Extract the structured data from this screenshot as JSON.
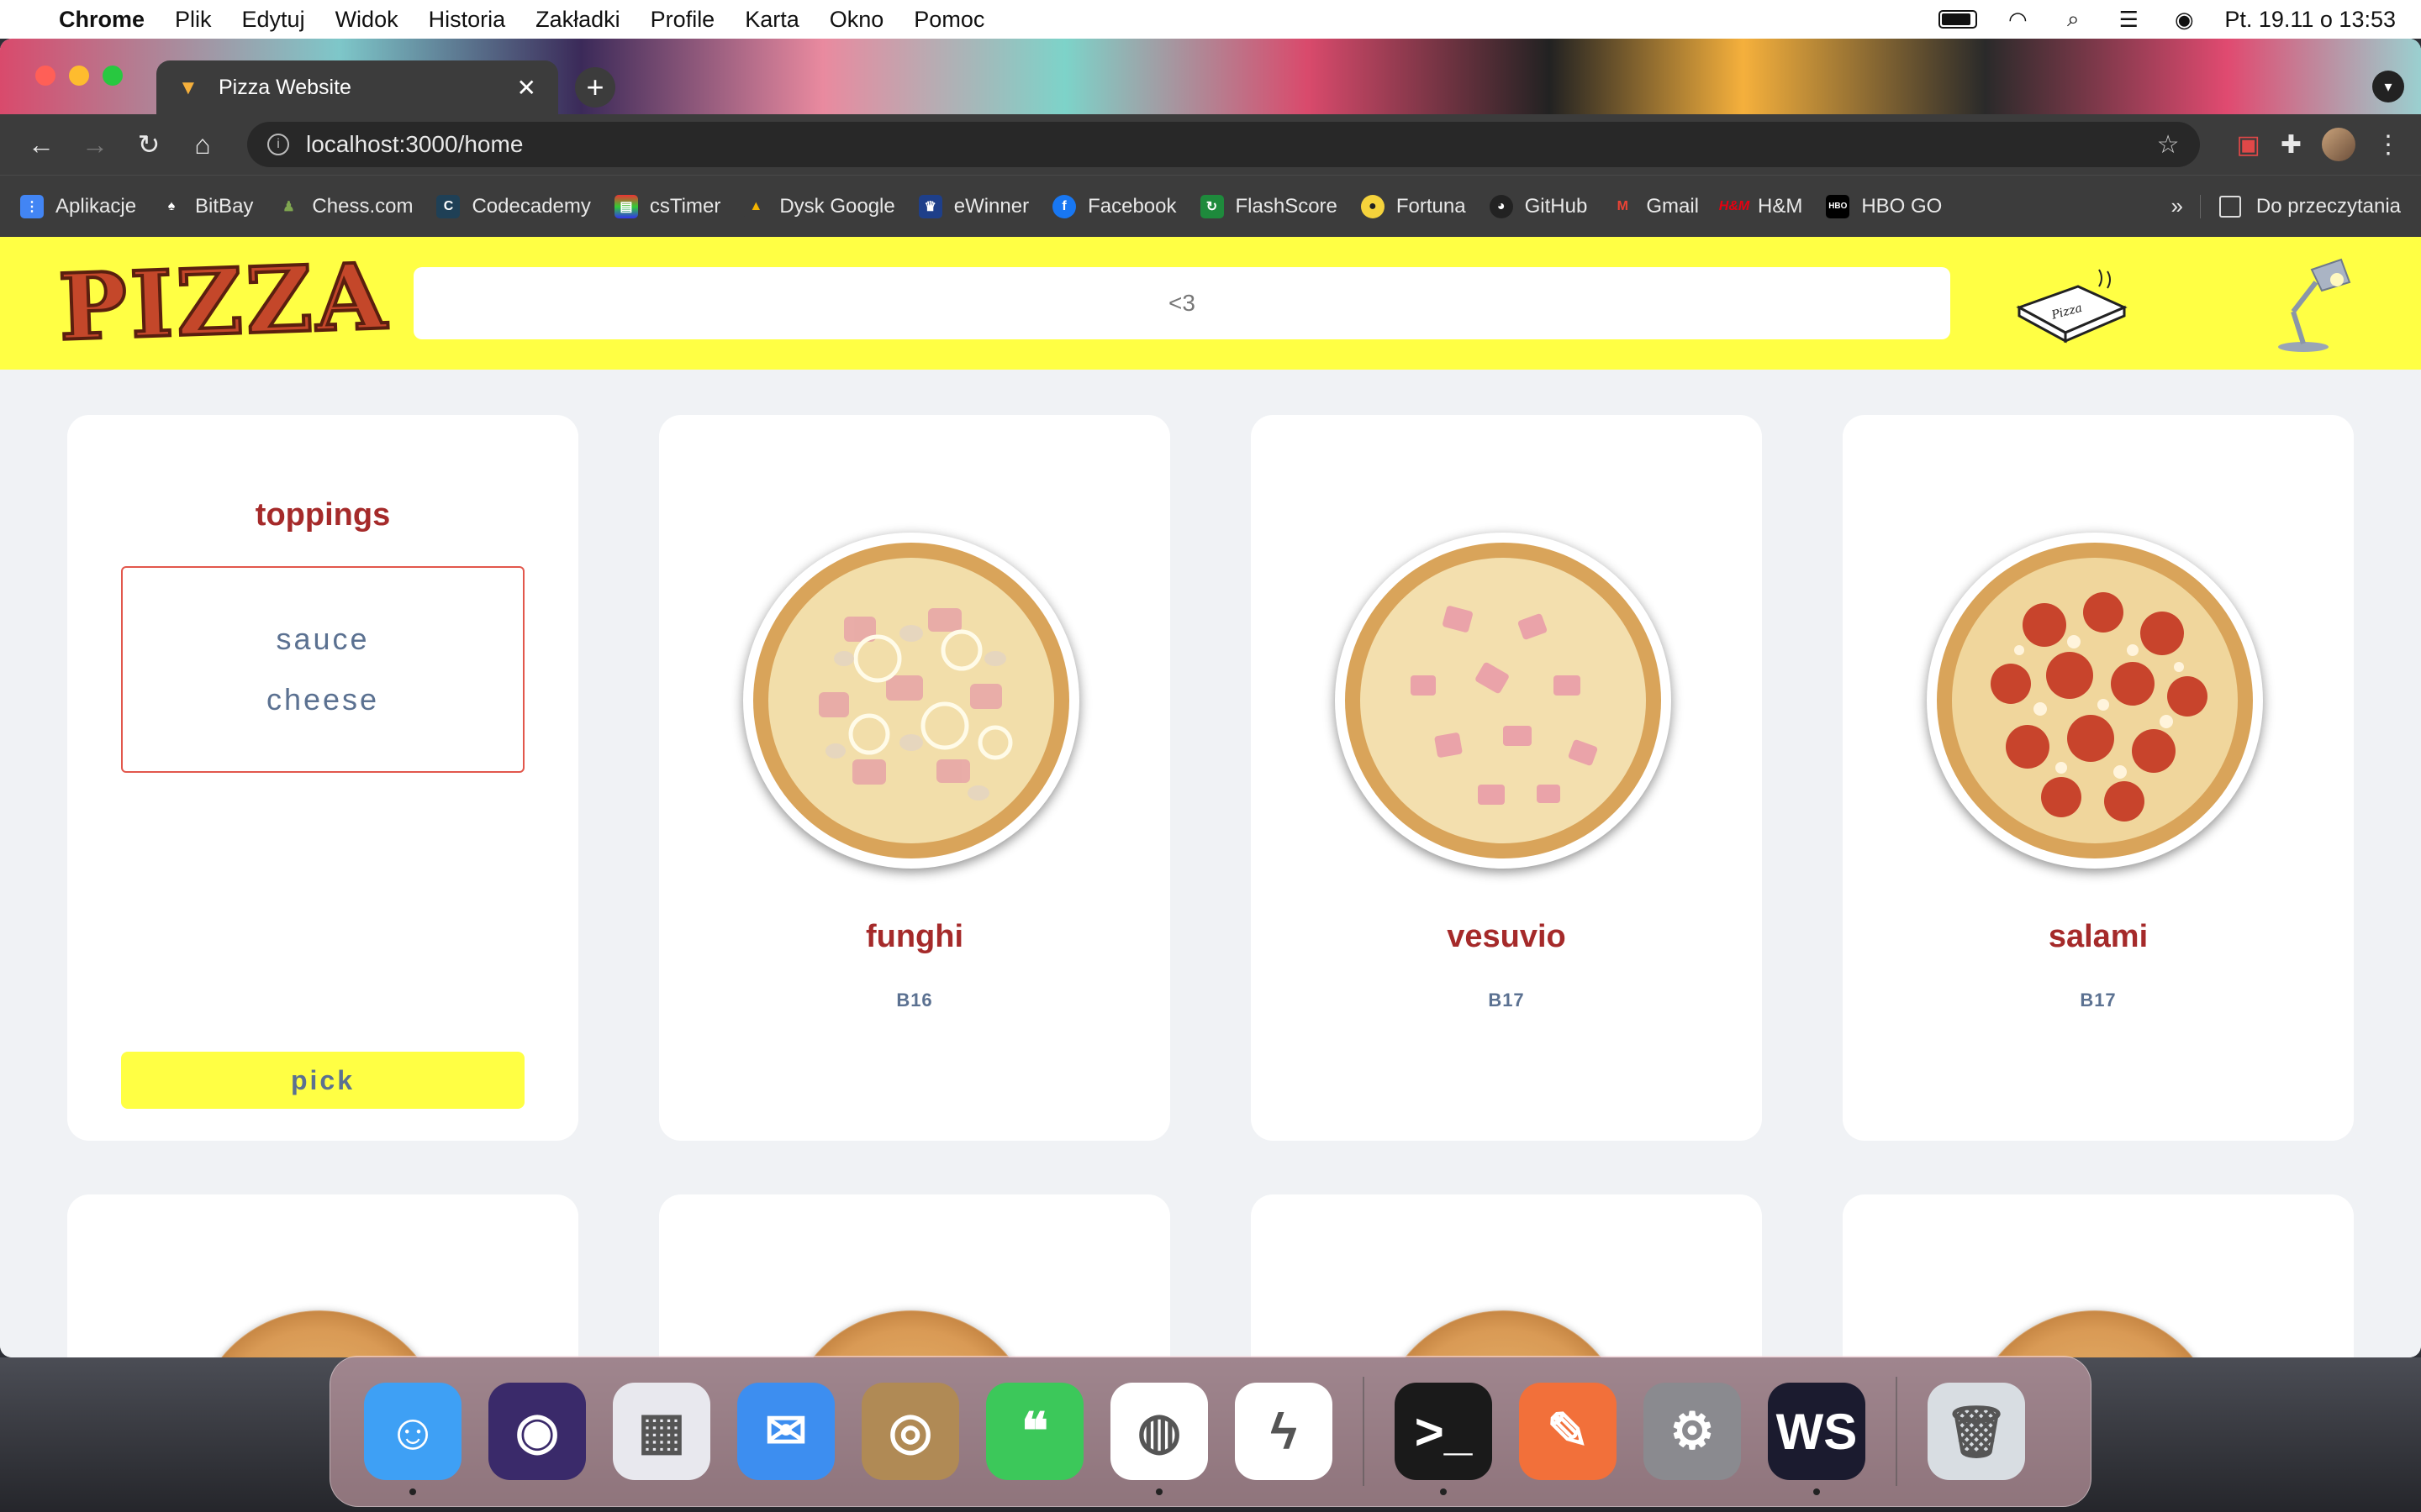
{
  "menubar": {
    "app": "Chrome",
    "items": [
      "Plik",
      "Edytuj",
      "Widok",
      "Historia",
      "Zakładki",
      "Profile",
      "Karta",
      "Okno",
      "Pomoc"
    ],
    "datetime": "Pt. 19.11 o  13:53"
  },
  "browser": {
    "tab_title": "Pizza Website",
    "url": "localhost:3000/home",
    "bookmarks": [
      {
        "label": "Aplikacje",
        "icon": "apps-grid-icon",
        "color": "#4285f4"
      },
      {
        "label": "BitBay",
        "icon": "bitbay-icon",
        "color": "#3c3c3c"
      },
      {
        "label": "Chess.com",
        "icon": "chess-pawn-icon",
        "color": "#7fa650"
      },
      {
        "label": "Codecademy",
        "icon": "codecademy-icon",
        "color": "#1f4056"
      },
      {
        "label": "csTimer",
        "icon": "cstimer-icon",
        "color": "#888888"
      },
      {
        "label": "Dysk Google",
        "icon": "google-drive-icon",
        "color": "#0f9d58"
      },
      {
        "label": "eWinner",
        "icon": "ewinner-icon",
        "color": "#1e3f8a"
      },
      {
        "label": "Facebook",
        "icon": "facebook-icon",
        "color": "#1877f2"
      },
      {
        "label": "FlashScore",
        "icon": "flashscore-icon",
        "color": "#1e8a3c"
      },
      {
        "label": "Fortuna",
        "icon": "fortuna-icon",
        "color": "#f5d33c"
      },
      {
        "label": "GitHub",
        "icon": "github-icon",
        "color": "#222222"
      },
      {
        "label": "Gmail",
        "icon": "gmail-icon",
        "color": "#ea4335"
      },
      {
        "label": "H&M",
        "icon": "hm-icon",
        "color": "#e50010"
      },
      {
        "label": "HBO GO",
        "icon": "hbo-go-icon",
        "color": "#000000"
      }
    ],
    "bookmarks_more": "»",
    "reading_list": "Do przeczytania"
  },
  "site": {
    "search_value": "<3",
    "toppings": {
      "title": "toppings",
      "items": [
        "sauce",
        "cheese"
      ],
      "pick_label": "pick"
    },
    "pizzas": [
      {
        "name": "funghi",
        "code": "B16"
      },
      {
        "name": "vesuvio",
        "code": "B17"
      },
      {
        "name": "salami",
        "code": "B17"
      }
    ]
  },
  "dock": {
    "apps": [
      {
        "name": "finder",
        "color": "#3ea0f5",
        "glyph": "☺",
        "running": true
      },
      {
        "name": "siri",
        "color": "#3a2a6a",
        "glyph": "◉",
        "running": false
      },
      {
        "name": "launchpad",
        "color": "#e8e8ee",
        "glyph": "▦",
        "running": false
      },
      {
        "name": "mail",
        "color": "#3d8ef0",
        "glyph": "✉",
        "running": false
      },
      {
        "name": "contacts",
        "color": "#b08a55",
        "glyph": "◎",
        "running": false
      },
      {
        "name": "messages",
        "color": "#3cc85a",
        "glyph": "❝",
        "running": false
      },
      {
        "name": "chrome",
        "color": "#ffffff",
        "glyph": "◍",
        "running": true
      },
      {
        "name": "messenger",
        "color": "#ffffff",
        "glyph": "ϟ",
        "running": false
      },
      {
        "name": "terminal",
        "color": "#1a1a1a",
        "glyph": ">_",
        "running": true
      },
      {
        "name": "postman",
        "color": "#f2703a",
        "glyph": "✎",
        "running": false
      },
      {
        "name": "system-preferences",
        "color": "#8a8a8f",
        "glyph": "⚙",
        "running": false
      },
      {
        "name": "webstorm",
        "color": "#1b1b2f",
        "glyph": "WS",
        "running": true
      },
      {
        "name": "trash",
        "color": "#d8dde2",
        "glyph": "🗑",
        "running": false
      }
    ]
  }
}
